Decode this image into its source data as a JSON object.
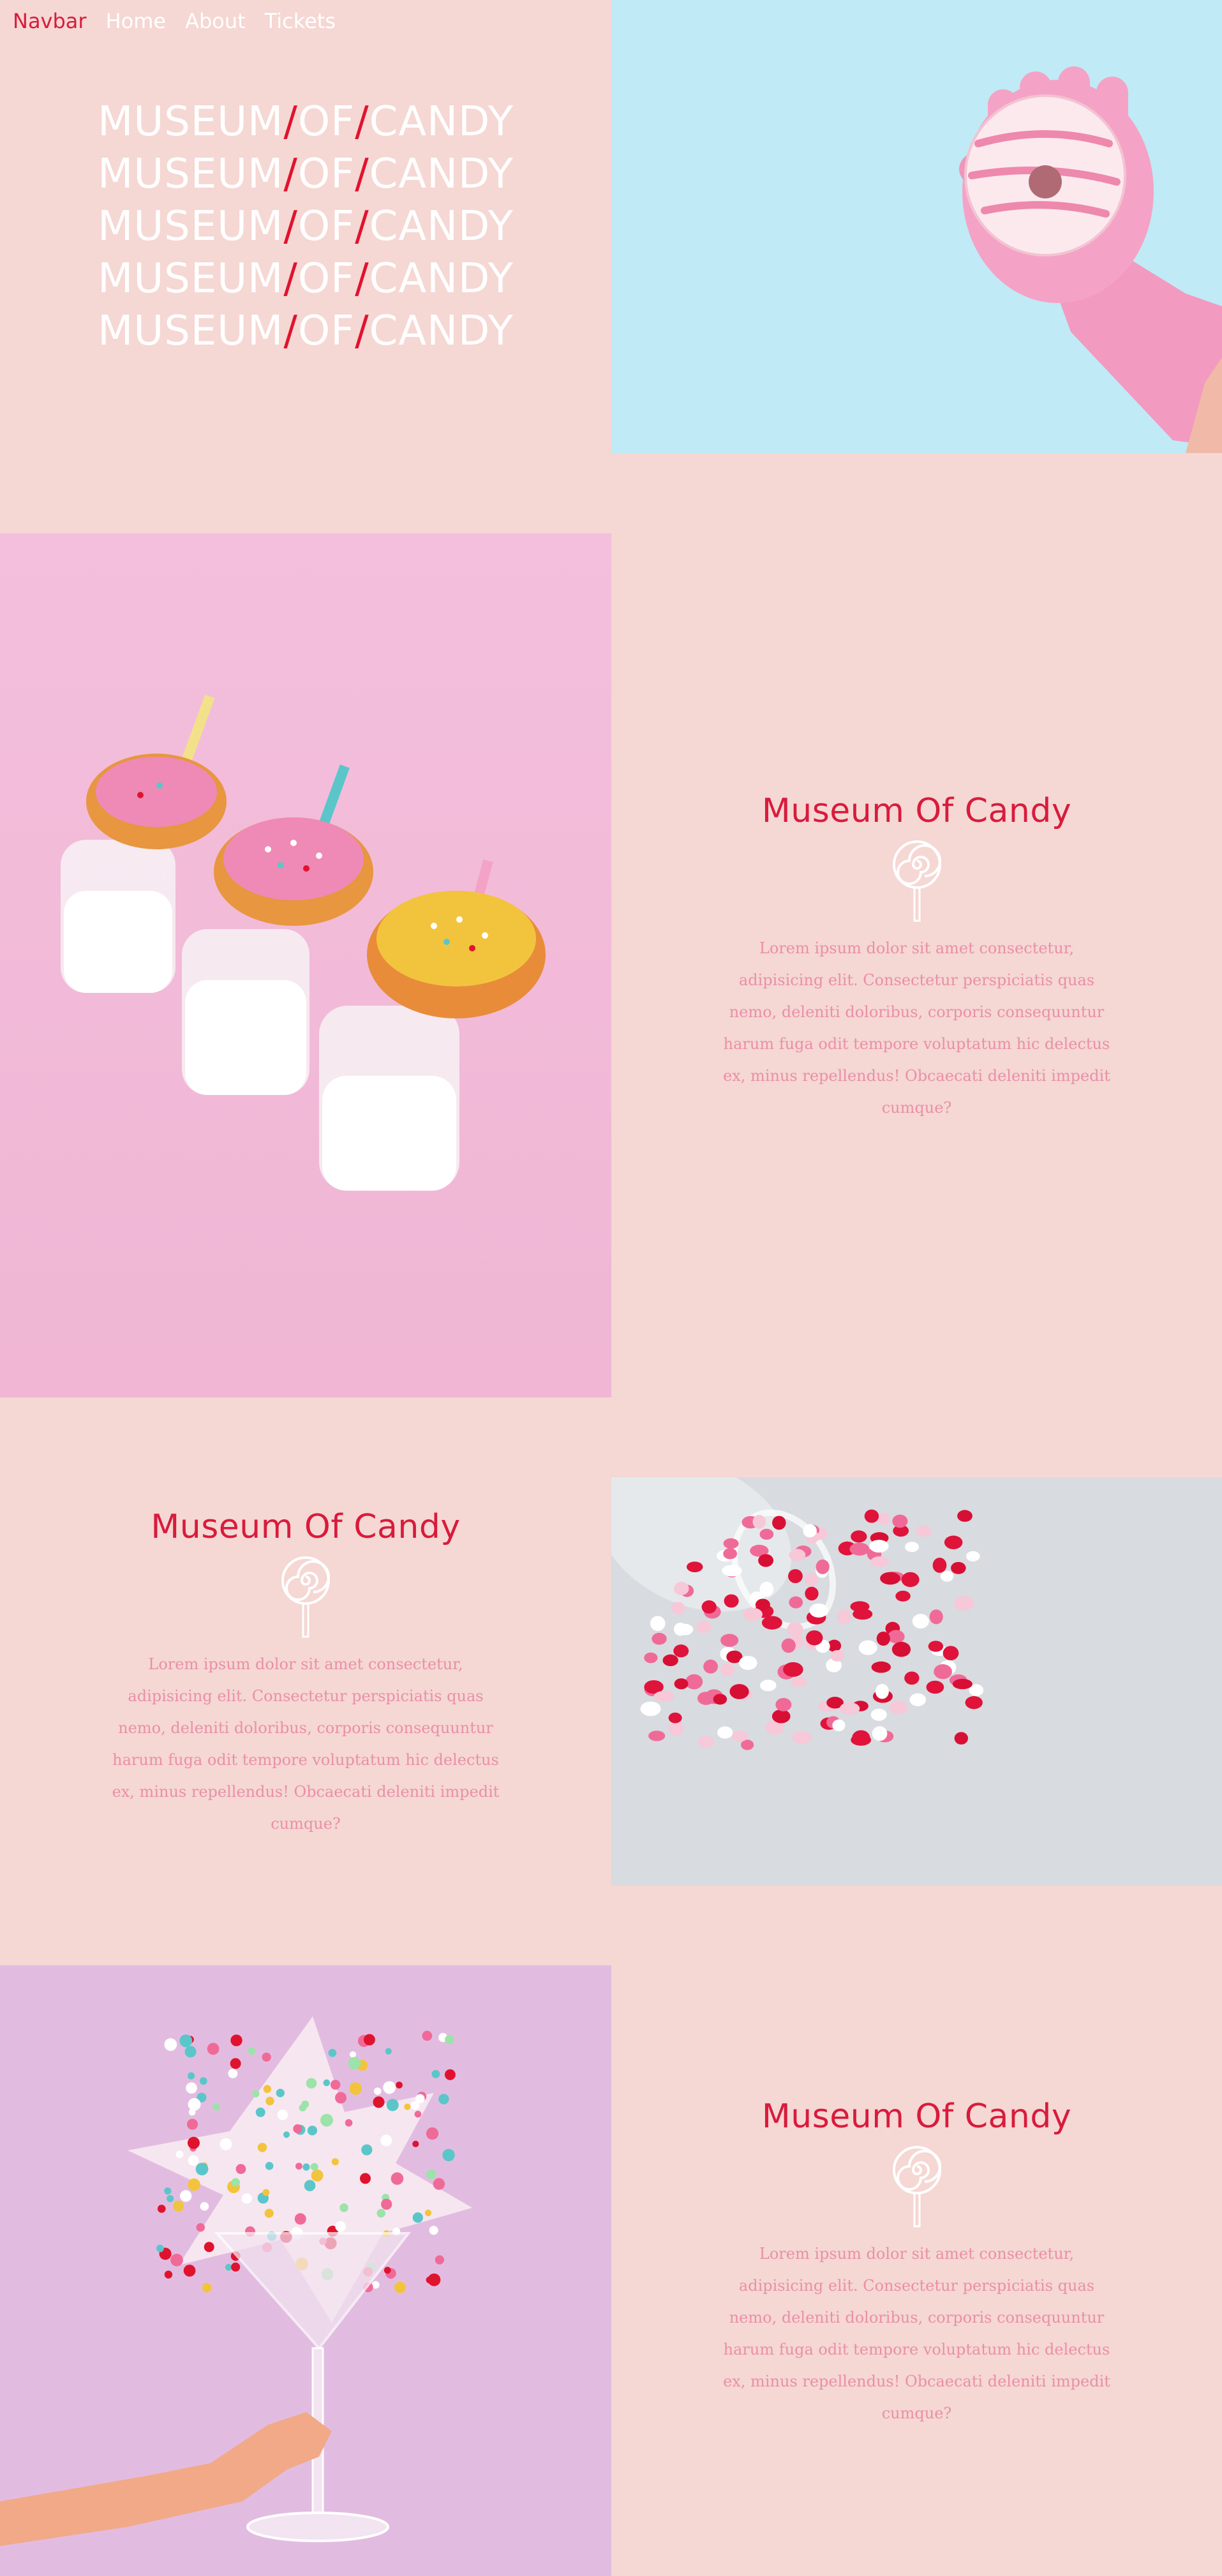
{
  "navbar": {
    "brand": "Navbar",
    "links": [
      "Home",
      "About",
      "Tickets"
    ]
  },
  "hero": {
    "title_words": [
      "MUSEUM",
      "OF",
      "CANDY"
    ],
    "separator": "/",
    "repeat_count": 5,
    "image": "donut-in-pink-glove"
  },
  "sections": [
    {
      "title": "Museum Of Candy",
      "icon": "lollipop-icon",
      "text": "Lorem ipsum dolor sit amet consectetur, adipisicing elit. Consectetur perspiciatis quas nemo, deleniti doloribus, corporis consequuntur harum fuga odit tempore voluptatum hic delectus ex, minus repellendus! Obcaecati deleniti impedit cumque?",
      "image": "donuts-on-milk-bottles"
    },
    {
      "title": "Museum Of Candy",
      "icon": "lollipop-icon",
      "text": "Lorem ipsum dolor sit amet consectetur, adipisicing elit. Consectetur perspiciatis quas nemo, deleniti doloribus, corporis consequuntur harum fuga odit tempore voluptatum hic delectus ex, minus repellendus! Obcaecati deleniti impedit cumque?",
      "image": "heart-sprinkles-jar"
    },
    {
      "title": "Museum Of Candy",
      "icon": "lollipop-icon",
      "text": "Lorem ipsum dolor sit amet consectetur, adipisicing elit. Consectetur perspiciatis quas nemo, deleniti doloribus, corporis consequuntur harum fuga odit tempore voluptatum hic delectus ex, minus repellendus! Obcaecati deleniti impedit cumque?",
      "image": "sprinkles-cocktail-glass"
    }
  ],
  "colors": {
    "background": "#f5d7d3",
    "accent": "#d81b3c",
    "text": "#ea8fa8",
    "sky": "#c0eaf6",
    "lilac": "#e2bce0"
  }
}
